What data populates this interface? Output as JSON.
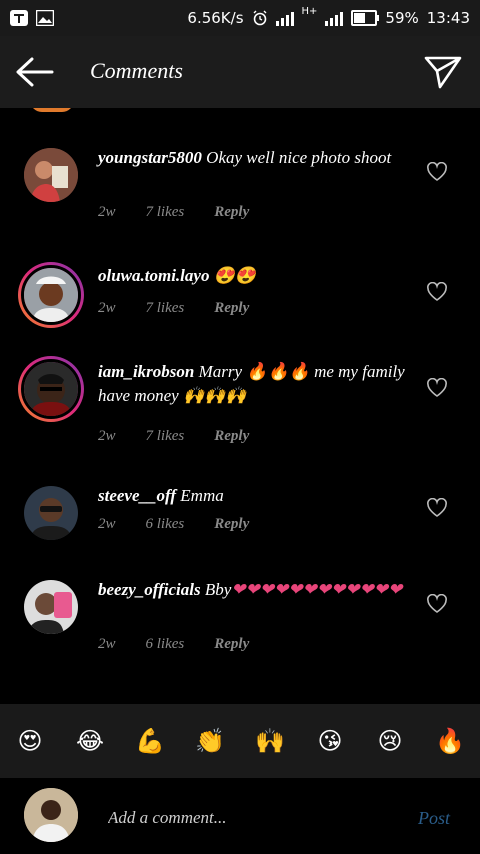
{
  "status_bar": {
    "speed": "6.56K/s",
    "network": "H+",
    "battery": "59%",
    "battery_level": 0.59,
    "time": "13:43"
  },
  "header": {
    "title": "Comments"
  },
  "comments": [
    {
      "username": "youngstar5800",
      "text": "Okay well nice photo shoot",
      "age": "2w",
      "likes": "7 likes",
      "reply": "Reply",
      "story_ring": false
    },
    {
      "username": "oluwa.tomi.layo",
      "text": "😍😍",
      "age": "2w",
      "likes": "7 likes",
      "reply": "Reply",
      "story_ring": true
    },
    {
      "username": "iam_ikrobson",
      "text_before": "Marry",
      "text_fire": "🔥🔥🔥",
      "text_after": "me my family have money",
      "text_hands": "🙌🙌🙌",
      "age": "2w",
      "likes": "7 likes",
      "reply": "Reply",
      "story_ring": true
    },
    {
      "username": "steeve__off",
      "text": "Emma",
      "age": "2w",
      "likes": "6 likes",
      "reply": "Reply",
      "story_ring": false
    },
    {
      "username": "beezy_officials",
      "text": "Bby",
      "hearts": "❤❤❤❤❤❤❤❤❤❤❤❤",
      "age": "2w",
      "likes": "6 likes",
      "reply": "Reply",
      "story_ring": false
    }
  ],
  "emoji_bar": [
    "😍",
    "😂",
    "💪",
    "👏",
    "🙌",
    "😘",
    "😢",
    "🔥"
  ],
  "composer": {
    "placeholder": "Add a comment...",
    "post_label": "Post"
  },
  "colors": {
    "background": "#000000",
    "bar": "#1a1a1a",
    "meta_text": "#8a8a8a",
    "post_disabled": "#2a5d8a"
  }
}
